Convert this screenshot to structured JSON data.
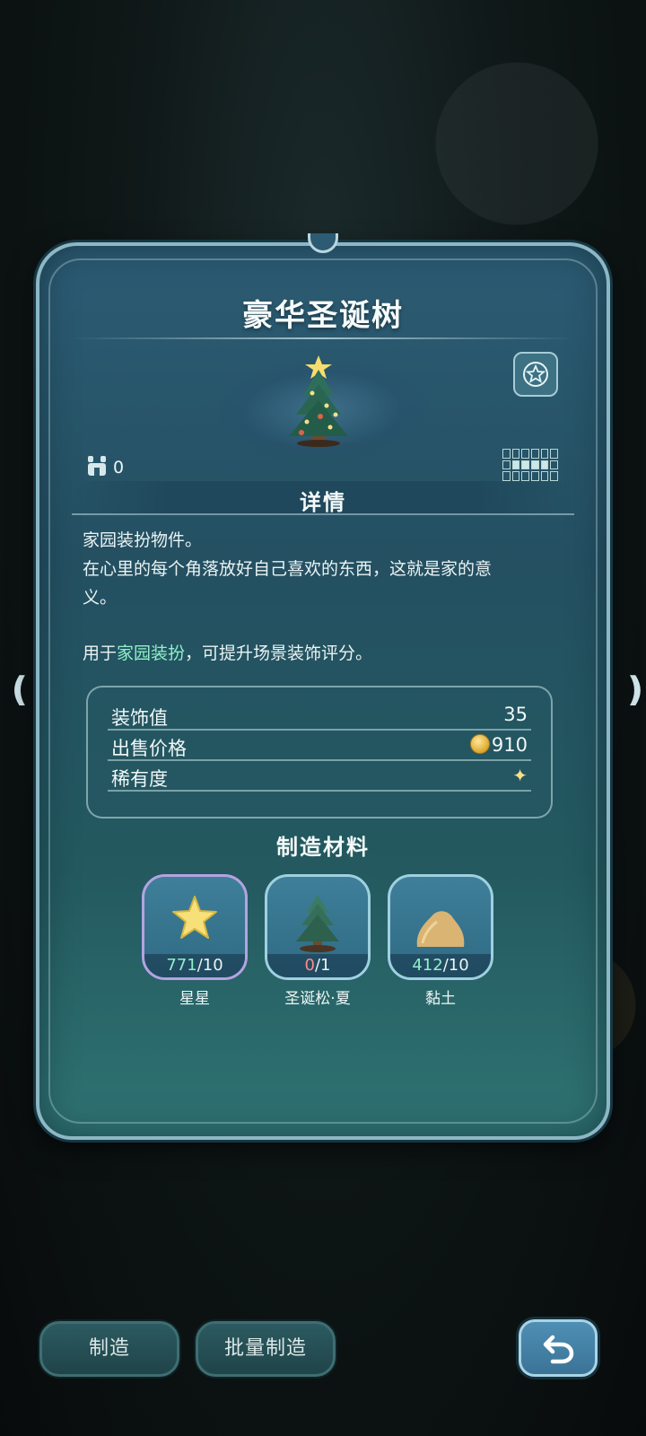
{
  "item": {
    "title": "豪华圣诞树",
    "owned_count": "0"
  },
  "details": {
    "header": "详情",
    "line1": "家园装扮物件。",
    "line2": "在心里的每个角落放好自己喜欢的东西，这就是家的意",
    "line3": "义。",
    "usage_prefix": "用于",
    "usage_highlight": "家园装扮",
    "usage_suffix": "，可提升场景装饰评分。"
  },
  "stats": {
    "decor_label": "装饰值",
    "decor_value": "35",
    "price_label": "出售价格",
    "price_value": "910",
    "rarity_label": "稀有度",
    "rarity_value": "✦"
  },
  "materials": {
    "header": "制造材料",
    "items": [
      {
        "name": "星星",
        "have": "771",
        "need": "/10",
        "icon": "star-icon"
      },
      {
        "name": "圣诞松·夏",
        "have": "0",
        "need": "/1",
        "icon": "pine-tree-icon"
      },
      {
        "name": "黏土",
        "have": "412",
        "need": "/10",
        "icon": "clay-icon"
      }
    ]
  },
  "buttons": {
    "make": "制造",
    "batch_make": "批量制造",
    "back": "back-arrow-icon"
  },
  "colors": {
    "highlight": "#8ff0c8",
    "insufficient": "#ff8a8a",
    "panel": "#2c5b73"
  }
}
